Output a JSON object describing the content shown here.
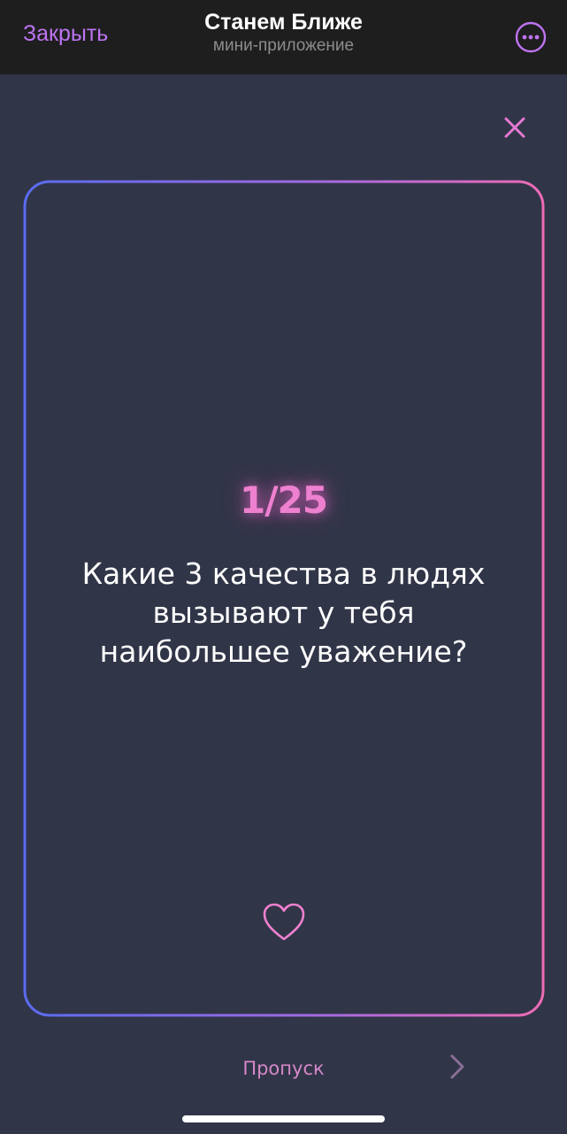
{
  "topbar": {
    "close_label": "Закрыть",
    "title": "Станем Ближе",
    "subtitle": "мини-приложение",
    "menu_icon": "more-horizontal-circle-icon"
  },
  "card": {
    "counter": "1/25",
    "question": "Какие 3 качества в людях вызывают у тебя наибольшее уважение?",
    "like_icon": "heart-outline-icon",
    "close_icon": "x-icon"
  },
  "footer": {
    "skip_label": "Пропуск",
    "next_icon": "chevron-right-icon"
  },
  "colors": {
    "background": "#313548",
    "topbar": "#1e1e1e",
    "accent_purple": "#bd74f2",
    "gradient_start": "#5a6cf0",
    "gradient_end": "#ee6cb6",
    "counter_pink": "#ee80d0"
  }
}
